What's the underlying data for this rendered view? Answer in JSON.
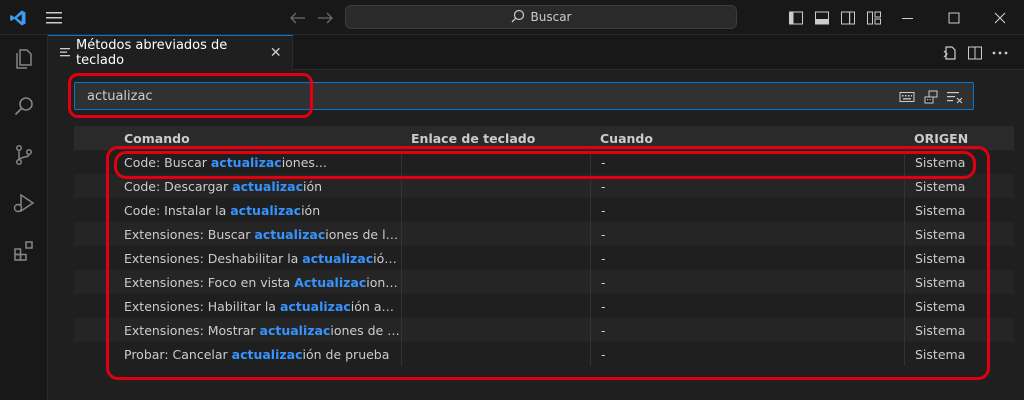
{
  "titlebar": {
    "search_label": "Buscar"
  },
  "tab": {
    "label": "Métodos abreviados de teclado",
    "close_glyph": "✕"
  },
  "search": {
    "value": "actualizac"
  },
  "table": {
    "headers": {
      "command": "Comando",
      "keybinding": "Enlace de teclado",
      "when": "Cuando",
      "source": "ORIGEN"
    },
    "rows": [
      {
        "pre": "Code: Buscar ",
        "match": "actualizac",
        "post": "iones...",
        "key": "",
        "when": "-",
        "source": "Sistema"
      },
      {
        "pre": "Code: Descargar ",
        "match": "actualizac",
        "post": "ión",
        "key": "",
        "when": "-",
        "source": "Sistema"
      },
      {
        "pre": "Code: Instalar la ",
        "match": "actualizac",
        "post": "ión",
        "key": "",
        "when": "-",
        "source": "Sistema"
      },
      {
        "pre": "Extensiones: Buscar ",
        "match": "actualizac",
        "post": "iones de la exte...",
        "key": "",
        "when": "-",
        "source": "Sistema"
      },
      {
        "pre": "Extensiones: Deshabilitar la ",
        "match": "actualizac",
        "post": "ión aut...",
        "key": "",
        "when": "-",
        "source": "Sistema"
      },
      {
        "pre": "Extensiones: Foco en vista ",
        "match": "Actualizac",
        "post": "iones dis...",
        "key": "",
        "when": "-",
        "source": "Sistema"
      },
      {
        "pre": "Extensiones: Habilitar la ",
        "match": "actualizac",
        "post": "ión automá...",
        "key": "",
        "when": "-",
        "source": "Sistema"
      },
      {
        "pre": "Extensiones: Mostrar ",
        "match": "actualizac",
        "post": "iones de la ext...",
        "key": "",
        "when": "-",
        "source": "Sistema"
      },
      {
        "pre": "Probar: Cancelar ",
        "match": "actualizac",
        "post": "ión de prueba",
        "key": "",
        "when": "-",
        "source": "Sistema"
      }
    ]
  },
  "colors": {
    "accent": "#0078d4",
    "highlight": "#3794ff",
    "annotation": "#e0000f"
  }
}
